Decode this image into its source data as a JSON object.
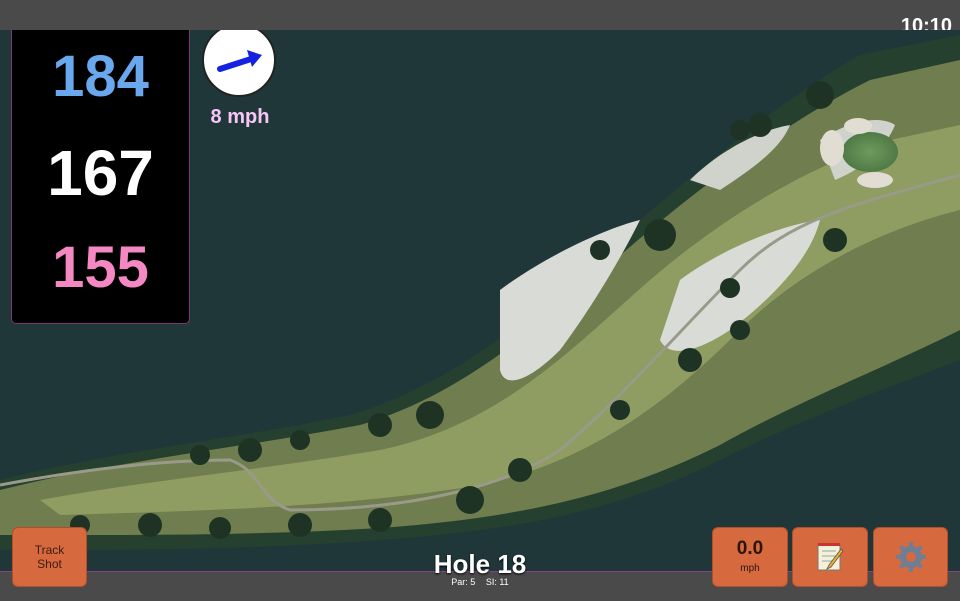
{
  "status": {
    "time": "10:10"
  },
  "distances": {
    "back": "184",
    "middle": "167",
    "front": "155"
  },
  "wind": {
    "speed_label": "8 mph",
    "icon": "wind-arrow-icon"
  },
  "hole": {
    "title": "Hole 18",
    "par": "Par: 5",
    "si": "SI: 11"
  },
  "buttons": {
    "track_shot": [
      "Track",
      "Shot"
    ],
    "speed_value": "0.0",
    "speed_unit": "mph",
    "notes_icon": "notepad-icon",
    "settings_icon": "gear-icon"
  },
  "colors": {
    "back_distance": "#6aa8ee",
    "middle_distance": "#ffffff",
    "front_distance": "#f388c3",
    "button": "#d6693e",
    "water": "#1f3639"
  }
}
